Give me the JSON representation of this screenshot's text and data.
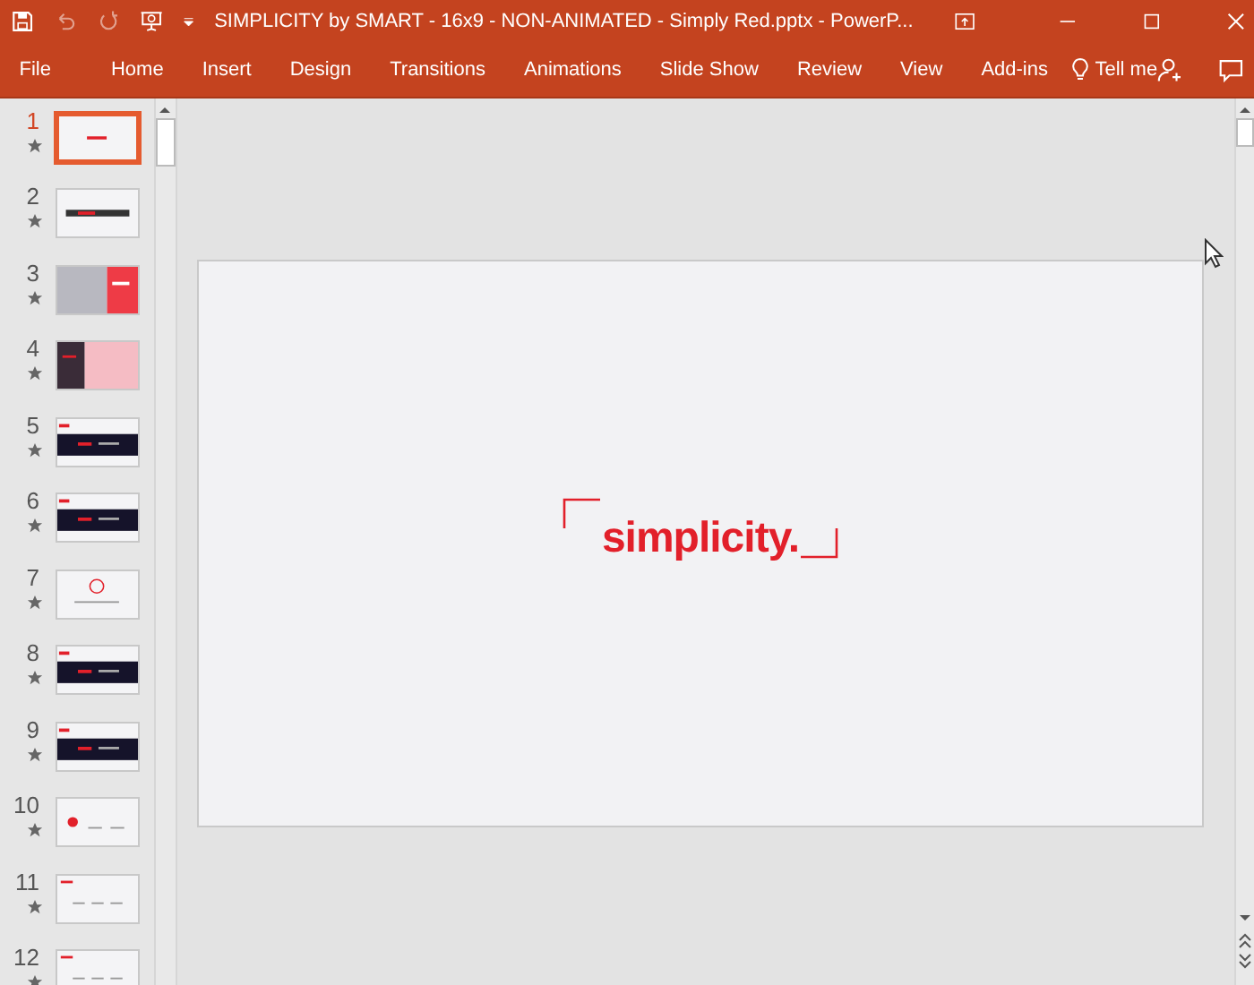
{
  "window": {
    "title": "SIMPLICITY by SMART - 16x9 - NON-ANIMATED - Simply Red.pptx  -  PowerP..."
  },
  "ribbon_tabs": [
    {
      "label": "File",
      "selected": false
    },
    {
      "label": "Home",
      "selected": false
    },
    {
      "label": "Insert",
      "selected": false
    },
    {
      "label": "Design",
      "selected": false
    },
    {
      "label": "Transitions",
      "selected": false
    },
    {
      "label": "Animations",
      "selected": false
    },
    {
      "label": "Slide Show",
      "selected": false
    },
    {
      "label": "Review",
      "selected": false
    },
    {
      "label": "View",
      "selected": false
    },
    {
      "label": "Add-ins",
      "selected": false
    }
  ],
  "tell_me": {
    "label": "Tell me"
  },
  "slides": [
    {
      "number": "1",
      "selected": true,
      "kind": "title"
    },
    {
      "number": "2",
      "selected": false,
      "kind": "banner"
    },
    {
      "number": "3",
      "selected": false,
      "kind": "split-red"
    },
    {
      "number": "4",
      "selected": false,
      "kind": "split-dark"
    },
    {
      "number": "5",
      "selected": false,
      "kind": "dark-band"
    },
    {
      "number": "6",
      "selected": false,
      "kind": "dark-band"
    },
    {
      "number": "7",
      "selected": false,
      "kind": "circle"
    },
    {
      "number": "8",
      "selected": false,
      "kind": "dark-band"
    },
    {
      "number": "9",
      "selected": false,
      "kind": "dark-band"
    },
    {
      "number": "10",
      "selected": false,
      "kind": "dot-row"
    },
    {
      "number": "11",
      "selected": false,
      "kind": "row"
    },
    {
      "number": "12",
      "selected": false,
      "kind": "row"
    }
  ],
  "slide": {
    "title": "simplicity."
  }
}
